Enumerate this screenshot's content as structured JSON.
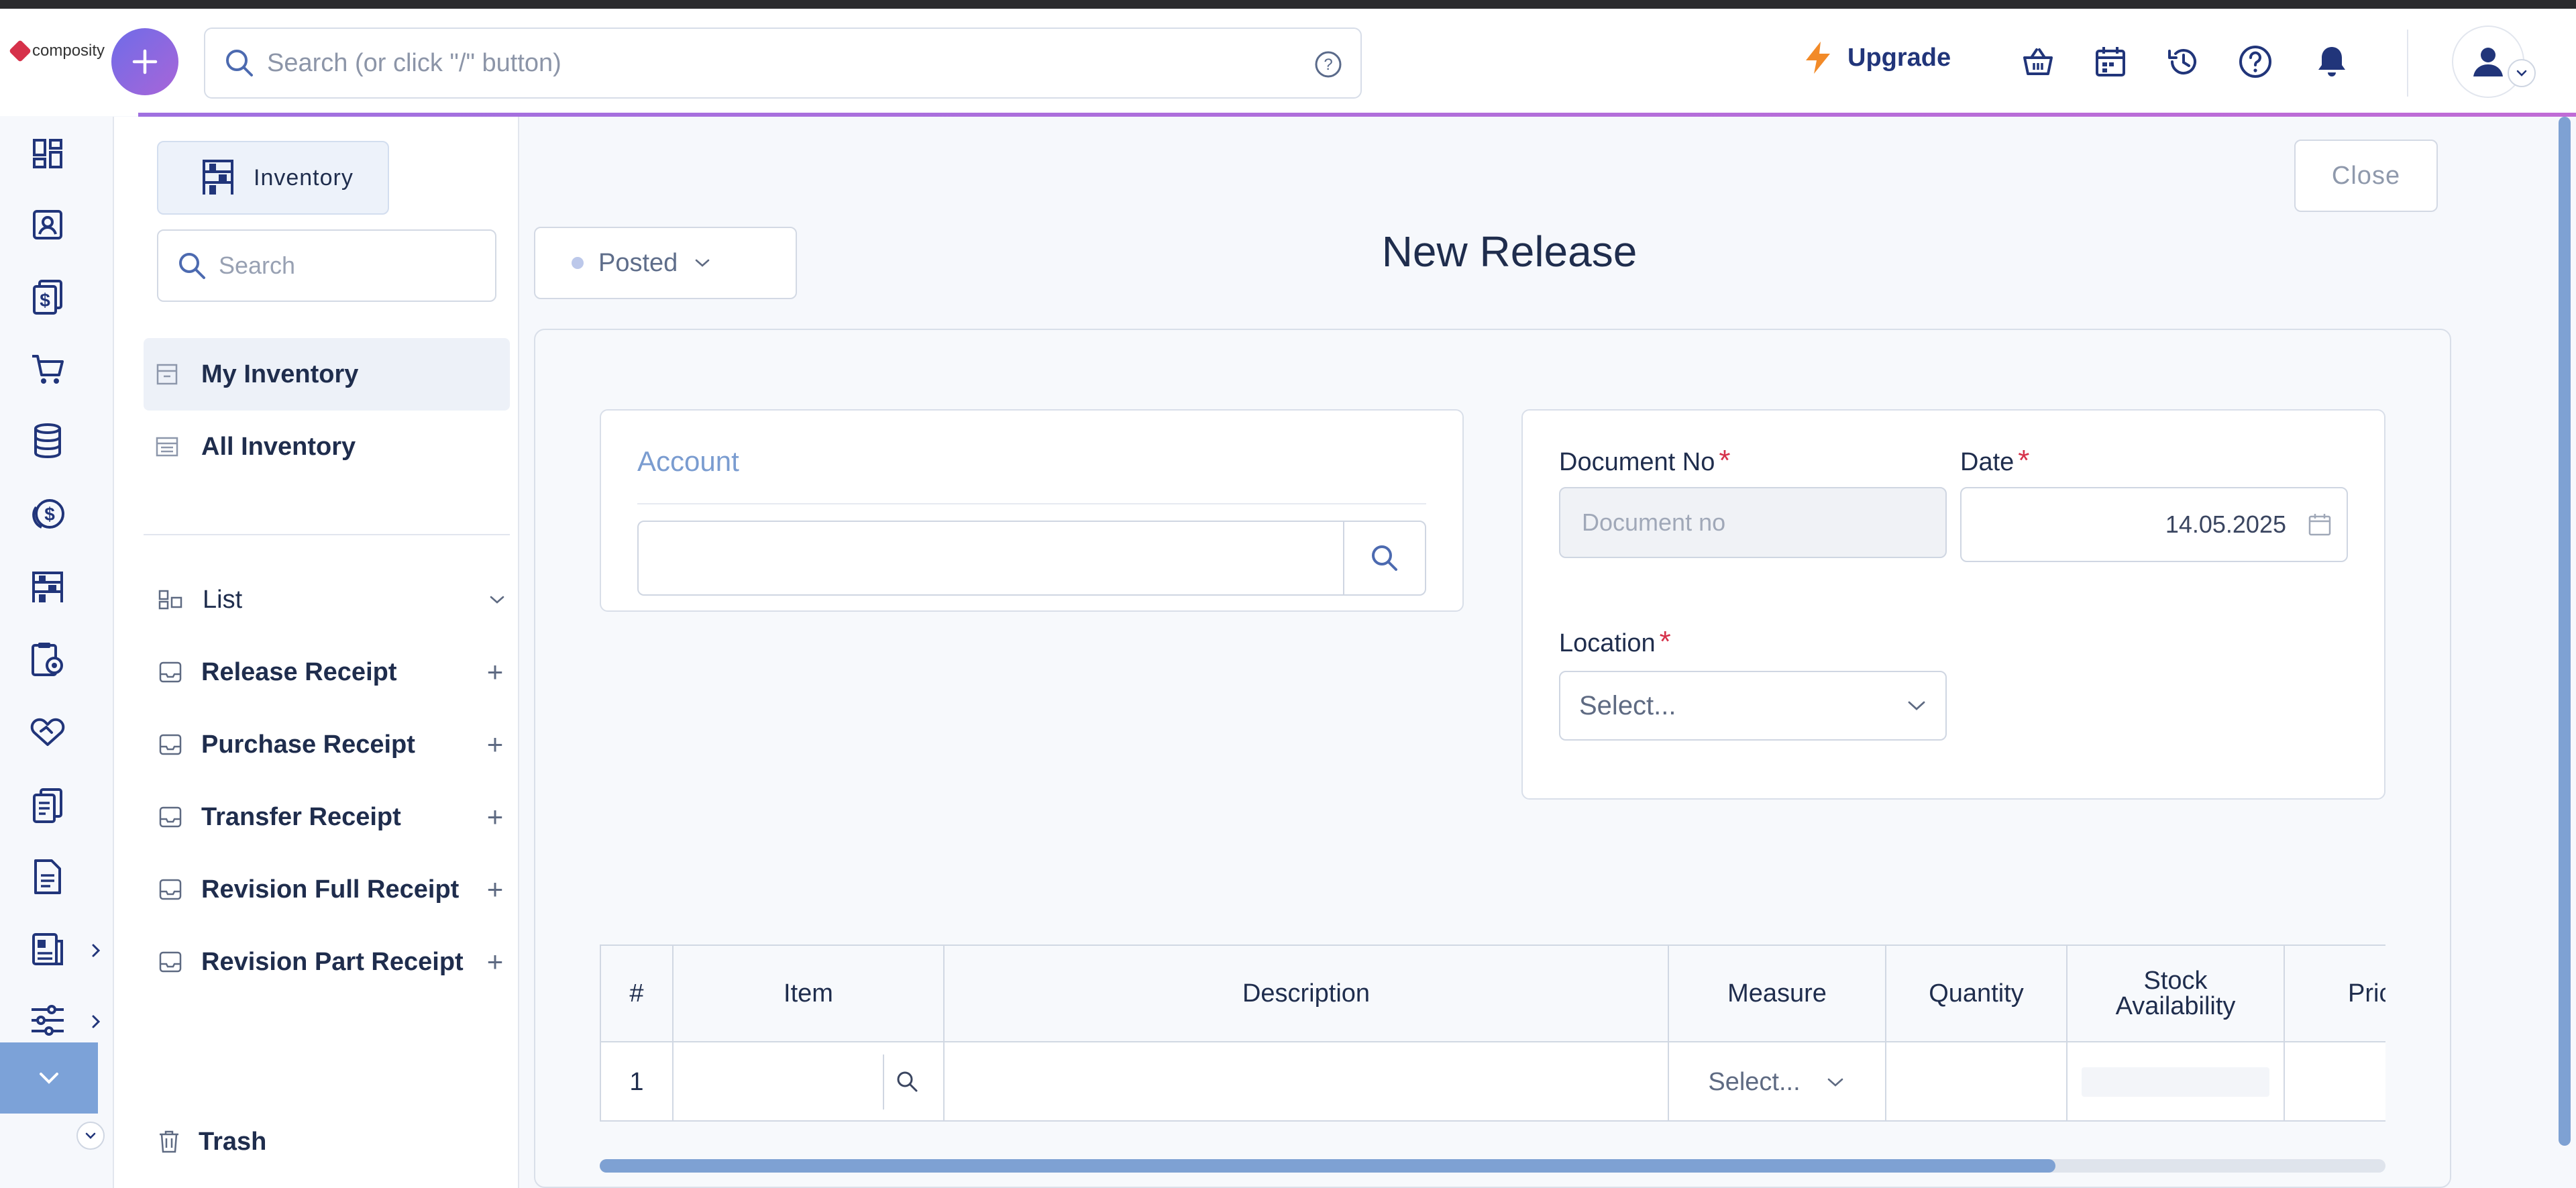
{
  "header": {
    "logo_text": "composity",
    "search_placeholder": "Search (or click \"/\" button)",
    "upgrade_label": "Upgrade",
    "icons": [
      "basket-icon",
      "calendar-icon",
      "history-icon",
      "help-icon",
      "bell-icon",
      "user-icon"
    ]
  },
  "rail": {
    "icons": [
      "dashboard-icon",
      "contacts-icon",
      "invoices-icon",
      "cart-icon",
      "database-icon",
      "money-icon",
      "inventory-icon",
      "clipboard-settings-icon",
      "handshake-icon",
      "documents-icon",
      "document-icon",
      "reports-icon",
      "settings-sliders-icon"
    ]
  },
  "sidebar": {
    "module_label": "Inventory",
    "search_placeholder": "Search",
    "nav": [
      {
        "label": "My Inventory"
      },
      {
        "label": "All Inventory"
      }
    ],
    "list_label": "List",
    "receipts": [
      {
        "label": "Release Receipt"
      },
      {
        "label": "Purchase Receipt"
      },
      {
        "label": "Transfer Receipt"
      },
      {
        "label": "Revision Full Receipt"
      },
      {
        "label": "Revision Part Receipt"
      }
    ],
    "trash_label": "Trash"
  },
  "main": {
    "close_label": "Close",
    "status_label": "Posted",
    "title": "New Release",
    "account": {
      "title": "Account",
      "value": ""
    },
    "document_no": {
      "label": "Document No",
      "required": "*",
      "placeholder": "Document no"
    },
    "date": {
      "label": "Date",
      "required": "*",
      "value": "14.05.2025"
    },
    "location": {
      "label": "Location",
      "required": "*",
      "placeholder": "Select..."
    }
  },
  "table": {
    "columns": [
      "#",
      "Item",
      "Description",
      "Measure",
      "Quantity",
      "Stock Availability",
      "Price"
    ],
    "rows": [
      {
        "num": "1",
        "item": "",
        "description": "",
        "measure": "Select...",
        "quantity": "",
        "stock": "",
        "price": ""
      }
    ]
  },
  "colors": {
    "accent": "#7ca2d8",
    "brand_gradient_start": "#6f6ce8",
    "brand_gradient_end": "#a865d8",
    "upgrade": "#f28a28",
    "required": "#d6314a",
    "text_dark": "#1f2d4d"
  }
}
